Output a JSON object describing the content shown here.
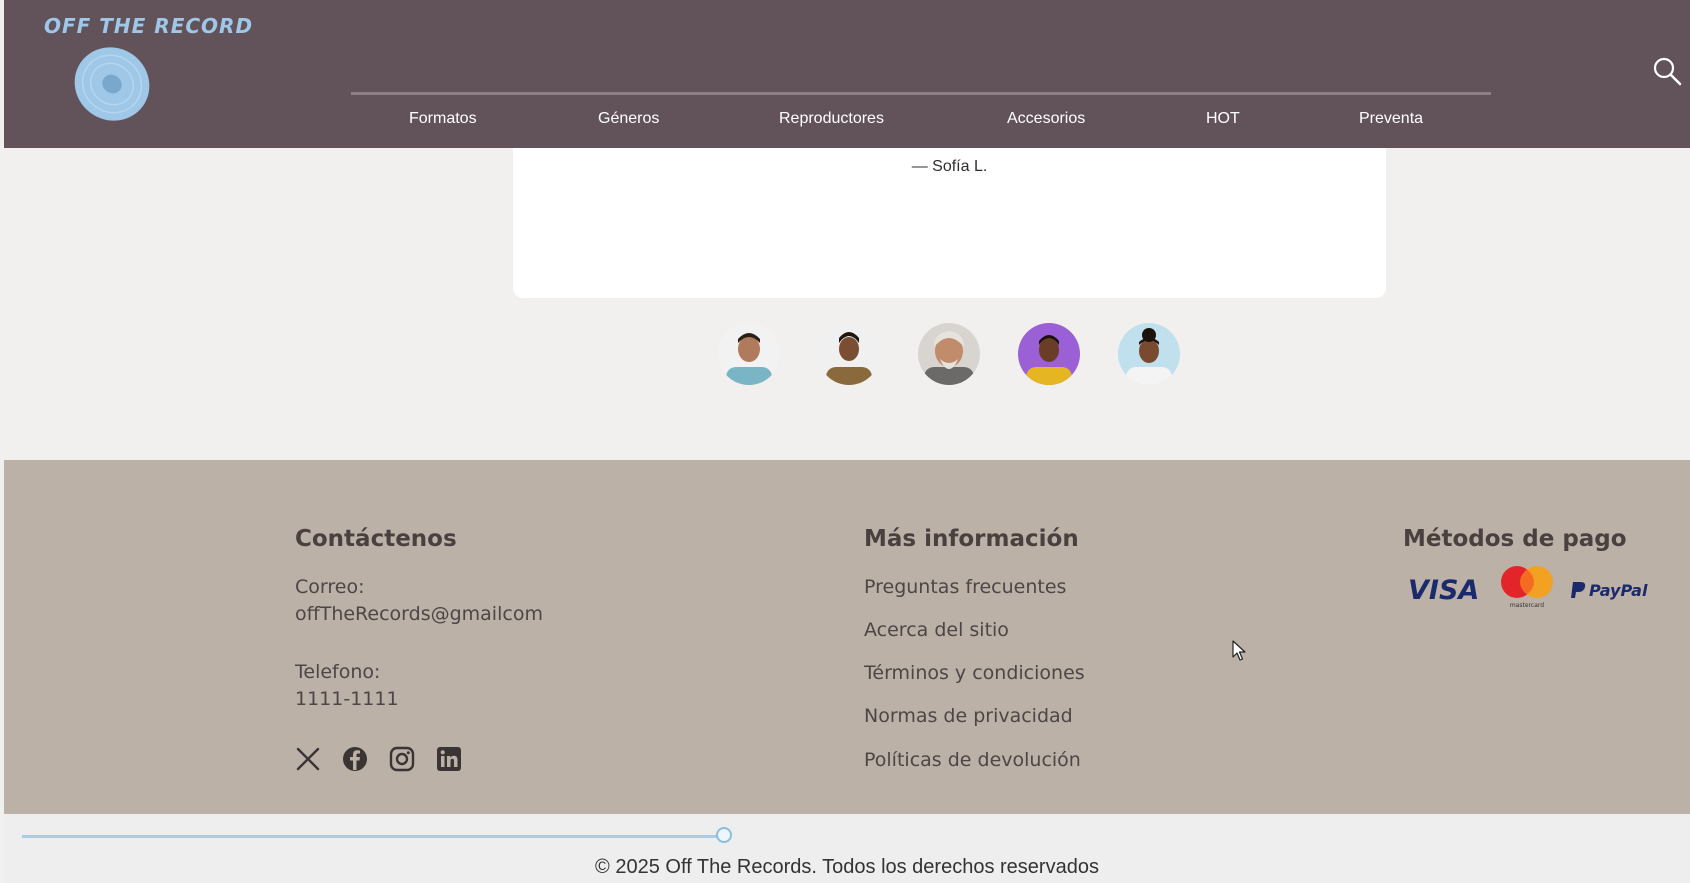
{
  "header": {
    "logo_text": "OFF THE RECORD",
    "nav": [
      {
        "label": "Formatos"
      },
      {
        "label": "Géneros"
      },
      {
        "label": "Reproductores"
      },
      {
        "label": "Accesorios"
      },
      {
        "label": "HOT"
      },
      {
        "label": "Preventa"
      }
    ],
    "search_icon": "search-icon"
  },
  "testimonial": {
    "author": "— Sofía L.",
    "avatars": [
      "avatar-1",
      "avatar-2",
      "avatar-3",
      "avatar-4",
      "avatar-5"
    ]
  },
  "footer": {
    "contact": {
      "title": "Contáctenos",
      "email_label": "Correo:",
      "email": "offTheRecords@gmailcom",
      "phone_label": "Telefono:",
      "phone": "1111-1111",
      "socials": [
        "x-icon",
        "facebook-icon",
        "instagram-icon",
        "linkedin-icon"
      ]
    },
    "info": {
      "title": "Más información",
      "links": [
        "Preguntas frecuentes",
        "Acerca del sitio",
        "Términos y condiciones",
        "Normas de privacidad",
        "Políticas de devolución"
      ]
    },
    "payment": {
      "title": "Métodos de pago",
      "methods": [
        "VISA",
        "mastercard",
        "PayPal"
      ]
    }
  },
  "bottom": {
    "copyright": "© 2025 Off The Records. Todos los derechos reservados"
  },
  "colors": {
    "header_bg": "#62535a",
    "footer_bg": "#bbb1a7",
    "accent": "#9ec7e8"
  }
}
